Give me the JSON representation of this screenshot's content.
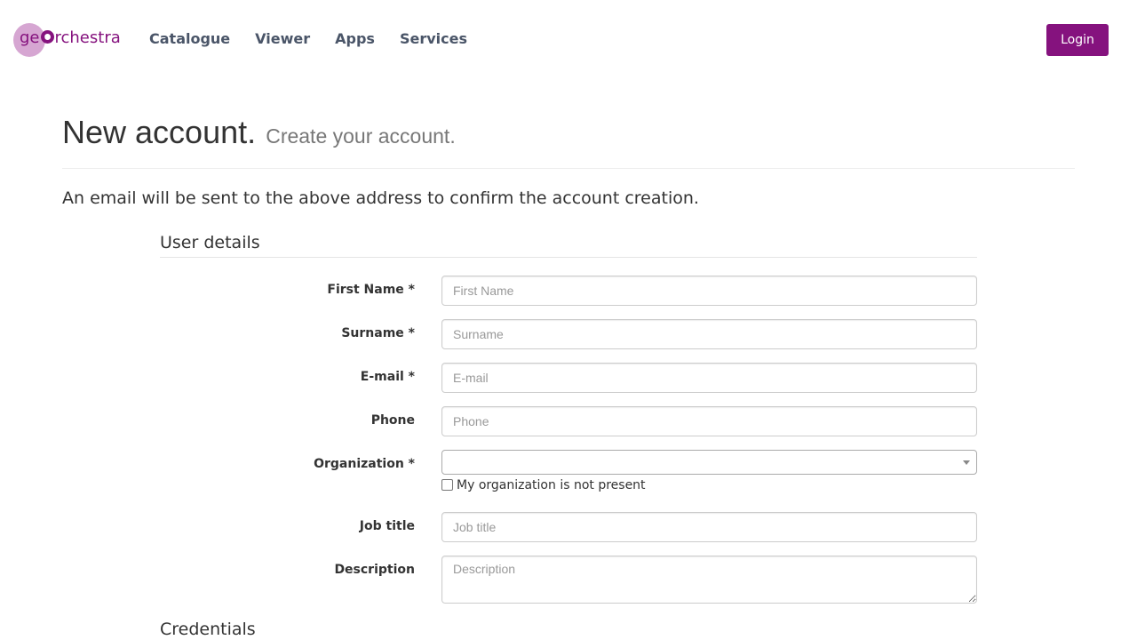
{
  "header": {
    "logo": {
      "prefix": "ge",
      "suffix": "rchestra"
    },
    "nav": [
      {
        "label": "Catalogue"
      },
      {
        "label": "Viewer"
      },
      {
        "label": "Apps"
      },
      {
        "label": "Services"
      }
    ],
    "login_label": "Login"
  },
  "page": {
    "title": "New account.",
    "subtitle": "Create your account.",
    "intro": "An email will be sent to the above address to confirm the account creation."
  },
  "form": {
    "user_details_legend": "User details",
    "credentials_legend": "Credentials",
    "first_name": {
      "label": "First Name *",
      "placeholder": "First Name",
      "value": ""
    },
    "surname": {
      "label": "Surname *",
      "placeholder": "Surname",
      "value": ""
    },
    "email": {
      "label": "E-mail *",
      "placeholder": "E-mail",
      "value": ""
    },
    "phone": {
      "label": "Phone",
      "placeholder": "Phone",
      "value": ""
    },
    "organization": {
      "label": "Organization *",
      "value": ""
    },
    "org_not_present_label": "My organization is not present",
    "job_title": {
      "label": "Job title",
      "placeholder": "Job title",
      "value": ""
    },
    "description": {
      "label": "Description",
      "placeholder": "Description",
      "value": ""
    }
  },
  "colors": {
    "brand": "#85127e",
    "brand_light": "#d6a6d2",
    "nav_text": "#4a5568"
  }
}
